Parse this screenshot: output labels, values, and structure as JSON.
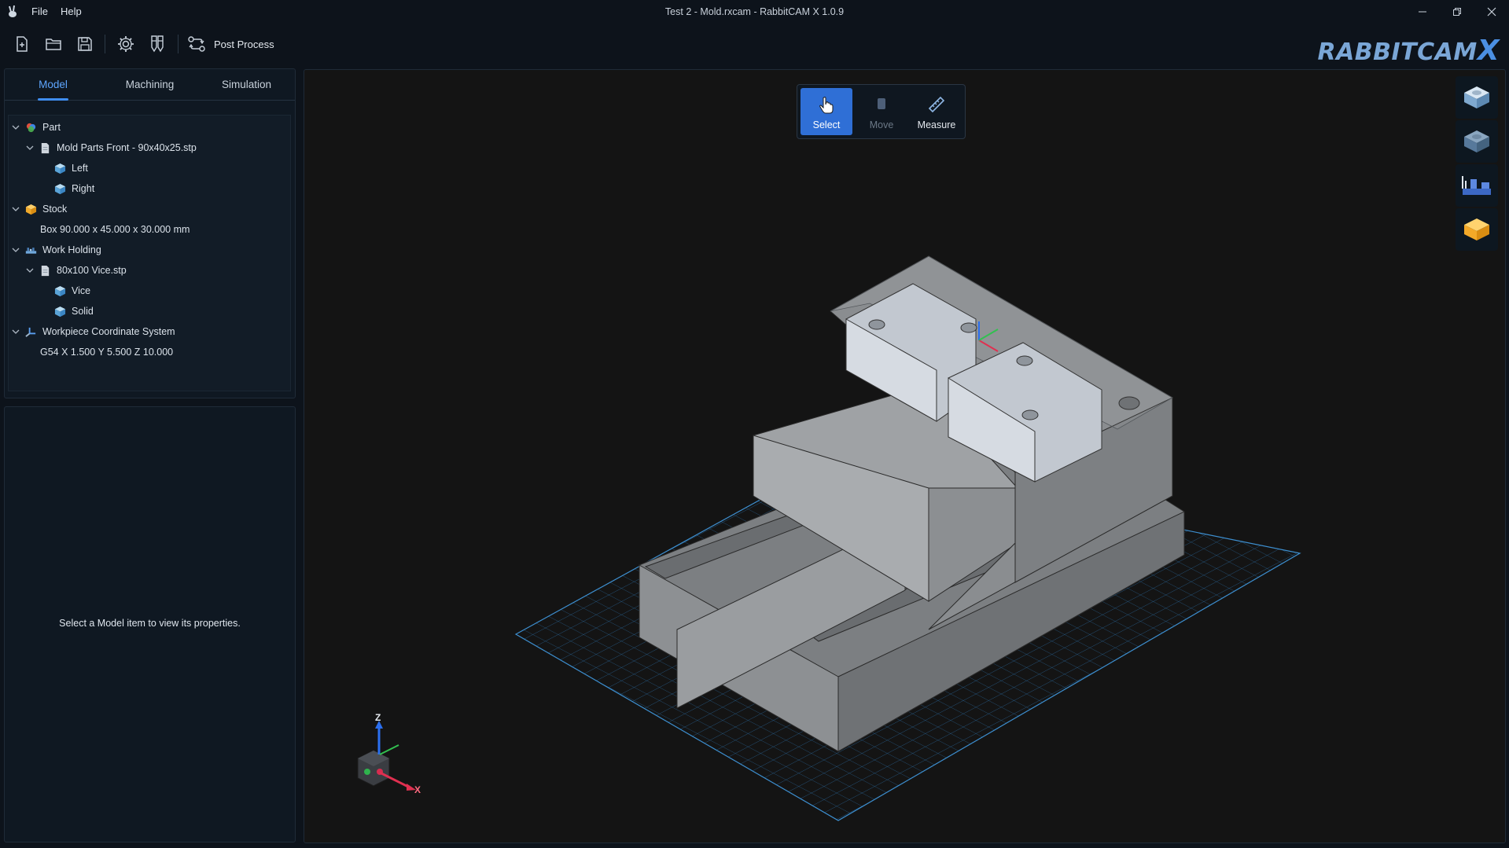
{
  "window": {
    "title": "Test 2 - Mold.rxcam - RabbitCAM X 1.0.9",
    "menu": [
      "File",
      "Help"
    ]
  },
  "toolbar": {
    "icons": [
      "new-file-icon",
      "open-folder-icon",
      "save-icon",
      "settings-icon",
      "tool-library-icon",
      "post-process-icon"
    ],
    "post_process_label": "Post Process"
  },
  "brand": {
    "name": "RABBITCAM",
    "suffix": "X",
    "colors": {
      "text": "#7aa6d6",
      "accent": "#4b8fe2"
    }
  },
  "tabs": [
    {
      "label": "Model",
      "active": true
    },
    {
      "label": "Machining",
      "active": false
    },
    {
      "label": "Simulation",
      "active": false
    }
  ],
  "tree": {
    "part": {
      "label": "Part",
      "file": "Mold Parts Front - 90x40x25.stp",
      "bodies": [
        "Left",
        "Right"
      ]
    },
    "stock": {
      "label": "Stock",
      "detail": "Box 90.000 x 45.000 x 30.000 mm"
    },
    "work_holding": {
      "label": "Work Holding",
      "file": "80x100 Vice.stp",
      "bodies": [
        "Vice",
        "Solid"
      ]
    },
    "wcs": {
      "label": "Workpiece Coordinate System",
      "detail": "G54  X 1.500  Y 5.500  Z 10.000"
    }
  },
  "properties": {
    "empty_message": "Select a Model item to view its properties."
  },
  "viewport_tools": [
    {
      "label": "Select",
      "state": "active",
      "icon": "pointer-hand-icon"
    },
    {
      "label": "Move",
      "state": "disabled",
      "icon": "move-block-icon"
    },
    {
      "label": "Measure",
      "state": "normal",
      "icon": "ruler-icon"
    }
  ],
  "right_rail": [
    "view-part-icon",
    "view-part-dark-icon",
    "view-vice-icon",
    "view-stock-icon"
  ],
  "triad": {
    "z_label": "Z",
    "x_label": "X"
  },
  "colors": {
    "accent": "#3f8df0",
    "background": "#0d131b",
    "viewport": "#141414",
    "grid": "#2a6ea8"
  }
}
